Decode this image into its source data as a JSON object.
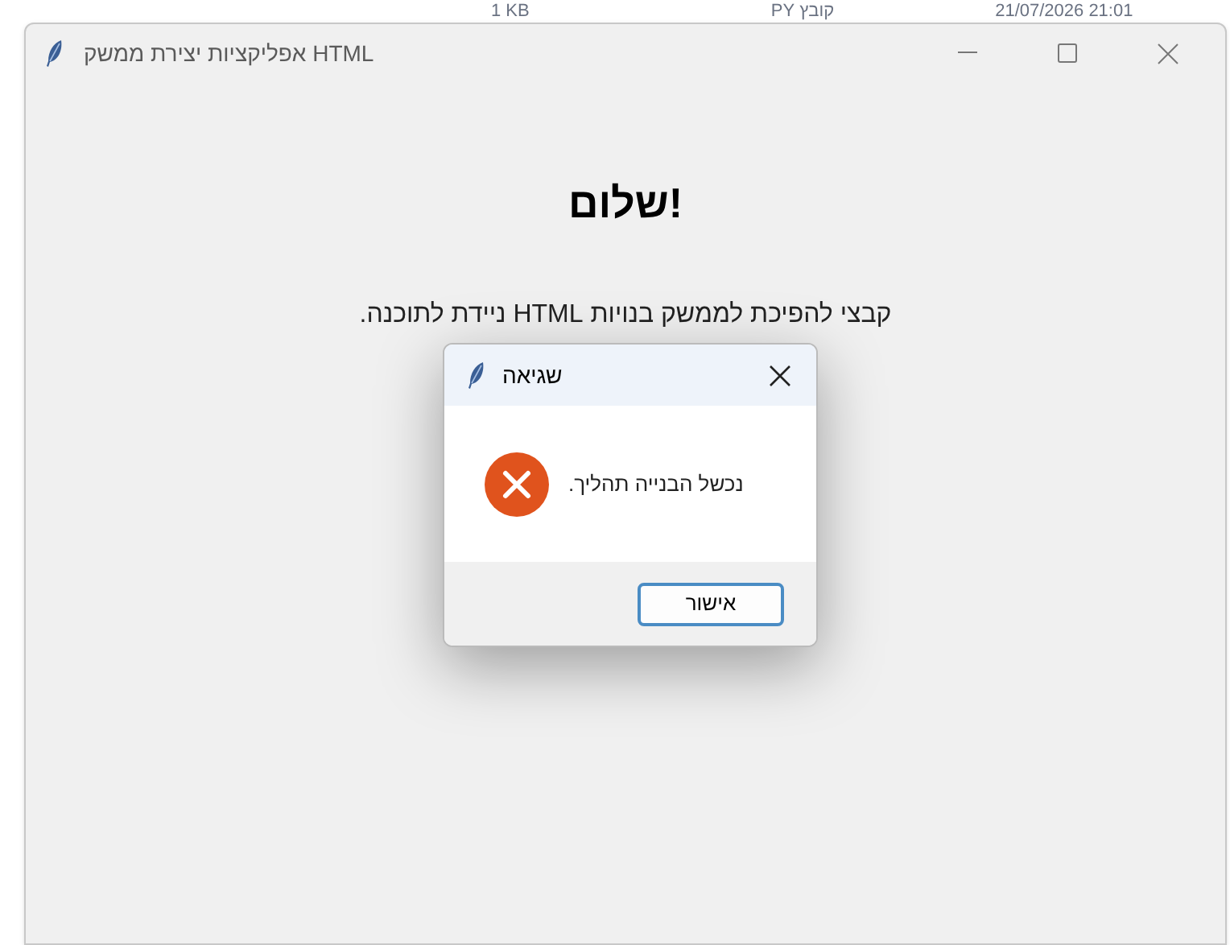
{
  "background_row": {
    "size": "1 KB",
    "type": "קובץ PY",
    "modified": "21/07/2026 21:01"
  },
  "window": {
    "title": "HTML אפליקציות יצירת ממשק"
  },
  "heading": "!שלום",
  "description": "קבצי להפיכת לממשק בנויות HTML ניידת לתוכנה.",
  "dialog": {
    "title": "שגיאה",
    "message": "נכשל הבנייה תהליך.",
    "buttons": [
      "אישור"
    ]
  }
}
